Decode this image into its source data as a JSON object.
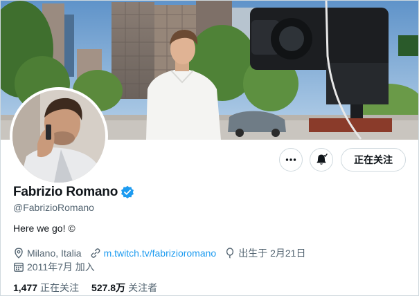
{
  "profile": {
    "display_name": "Fabrizio Romano",
    "handle": "@FabrizioRomano",
    "bio": "Here we go! ©",
    "location": "Milano, Italia",
    "website": "m.twitch.tv/fabrizioromano",
    "birthday": "出生于 2月21日",
    "joined": "2011年7月 加入",
    "verified": true
  },
  "actions": {
    "more_icon": "more-horizontal-icon",
    "notify_icon": "bell-icon",
    "follow_label": "正在关注"
  },
  "stats": {
    "following_count": "1,477",
    "following_label": "正在关注",
    "followers_count": "527.8万",
    "followers_label": "关注者"
  },
  "colors": {
    "accent": "#1d9bf0",
    "text_primary": "#0f1419",
    "text_secondary": "#536471",
    "border": "#cfd9de"
  }
}
